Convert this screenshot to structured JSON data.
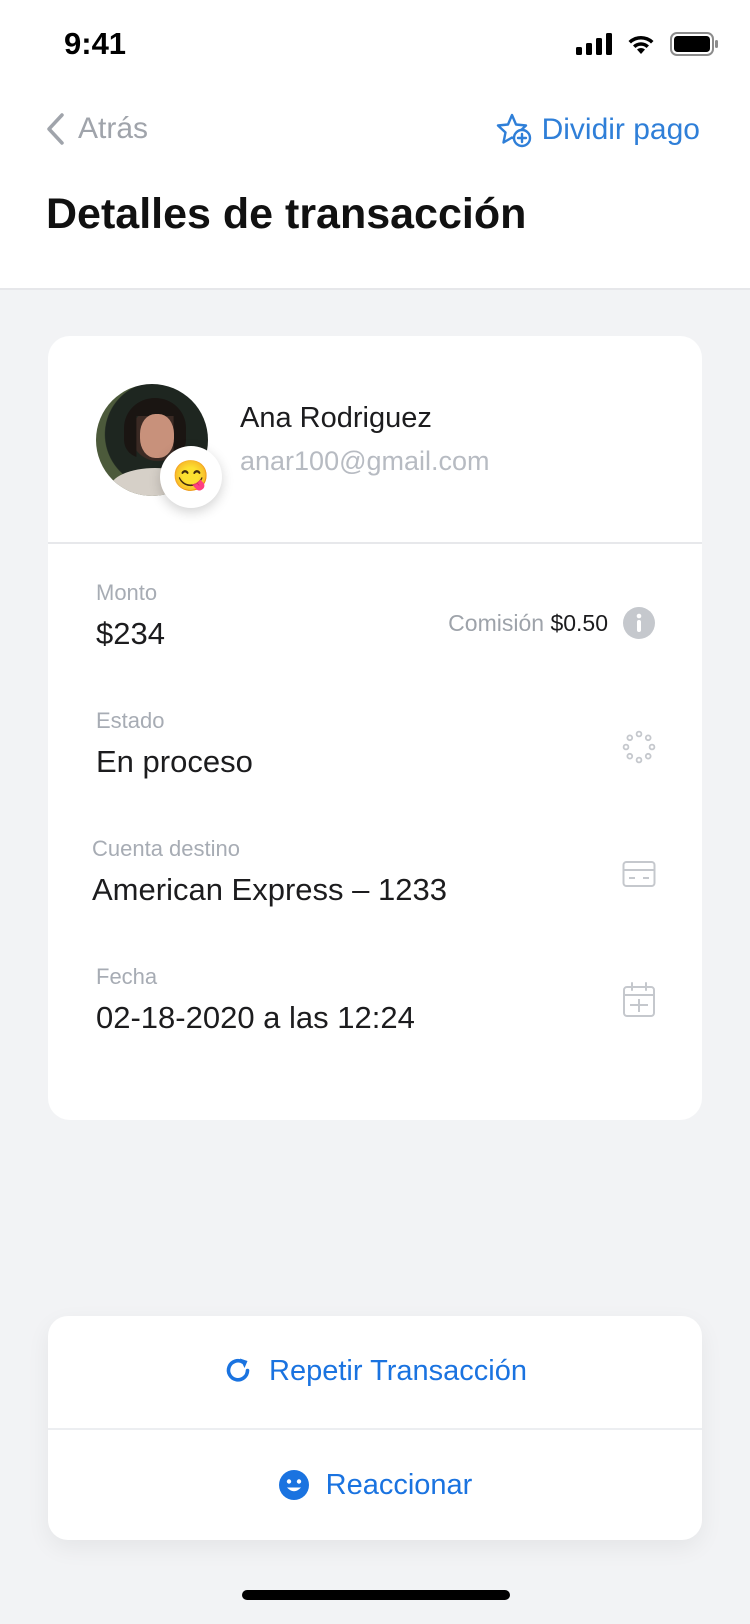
{
  "status_bar": {
    "time": "9:41"
  },
  "nav": {
    "back_label": "Atrás",
    "action_label": "Dividir pago"
  },
  "page": {
    "title": "Detalles de transacción"
  },
  "contact": {
    "name": "Ana Rodriguez",
    "email": "anar100@gmail.com",
    "reaction_emoji": "😋"
  },
  "details": {
    "amount_label": "Monto",
    "amount_value": "$234",
    "fee_label": "Comisión",
    "fee_value": "$0.50",
    "status_label": "Estado",
    "status_value": "En proceso",
    "account_label": "Cuenta destino",
    "account_value": "American Express – 1233",
    "date_label": "Fecha",
    "date_value": "02-18-2020 a las 12:24"
  },
  "actions": {
    "repeat_label": "Repetir Transacción",
    "react_label": "Reaccionar"
  },
  "colors": {
    "accent": "#1a73e0",
    "link": "#2f7fd8",
    "muted": "#a7acb4",
    "background": "#f2f3f5"
  },
  "icons": [
    "signal-icon",
    "wifi-icon",
    "battery-icon",
    "chevron-left-icon",
    "star-plus-icon",
    "info-icon",
    "loading-spinner-icon",
    "credit-card-icon",
    "calendar-icon",
    "refresh-icon",
    "smiley-icon"
  ]
}
